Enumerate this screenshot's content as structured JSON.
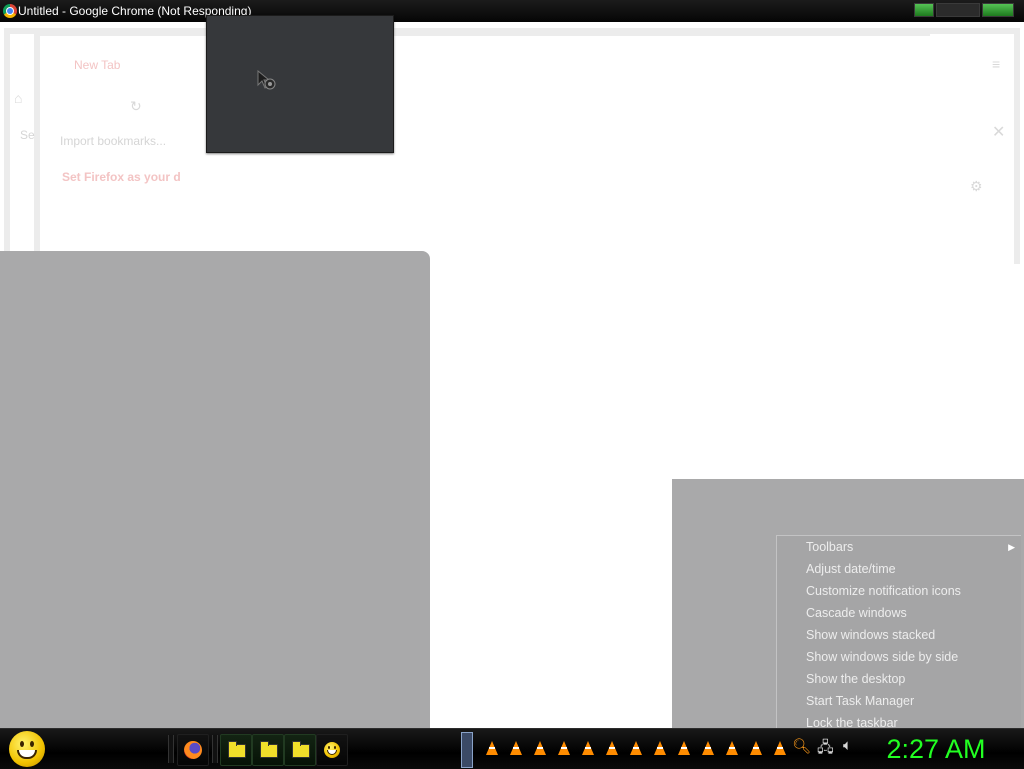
{
  "window": {
    "title": "Untitled - Google Chrome (Not Responding)",
    "icon": "chrome-icon"
  },
  "ghost_browser": {
    "tab_title": "New Tab",
    "import_bookmarks": "Import bookmarks...",
    "set_default": "Set Firefox as your d",
    "search_label": "Se"
  },
  "context_menu": {
    "items": [
      {
        "label": "Toolbars",
        "submenu": true
      },
      {
        "label": "Adjust date/time"
      },
      {
        "label": "Customize notification icons"
      },
      {
        "label": "Cascade windows"
      },
      {
        "label": "Show windows stacked"
      },
      {
        "label": "Show windows side by side"
      },
      {
        "label": "Show the desktop"
      },
      {
        "label": "Start Task Manager"
      },
      {
        "label": "Lock the taskbar"
      }
    ]
  },
  "taskbar": {
    "start_icon": "smiley-icon",
    "buttons": [
      "firefox-icon",
      "folder-icon",
      "folder-icon",
      "folder-icon",
      "smiley-icon"
    ],
    "tray_cone_count": 13,
    "tray_icons": [
      "search-icon",
      "network-icon",
      "volume-icon"
    ],
    "clock": "2:27 AM",
    "clock_color": "#22ff22"
  }
}
